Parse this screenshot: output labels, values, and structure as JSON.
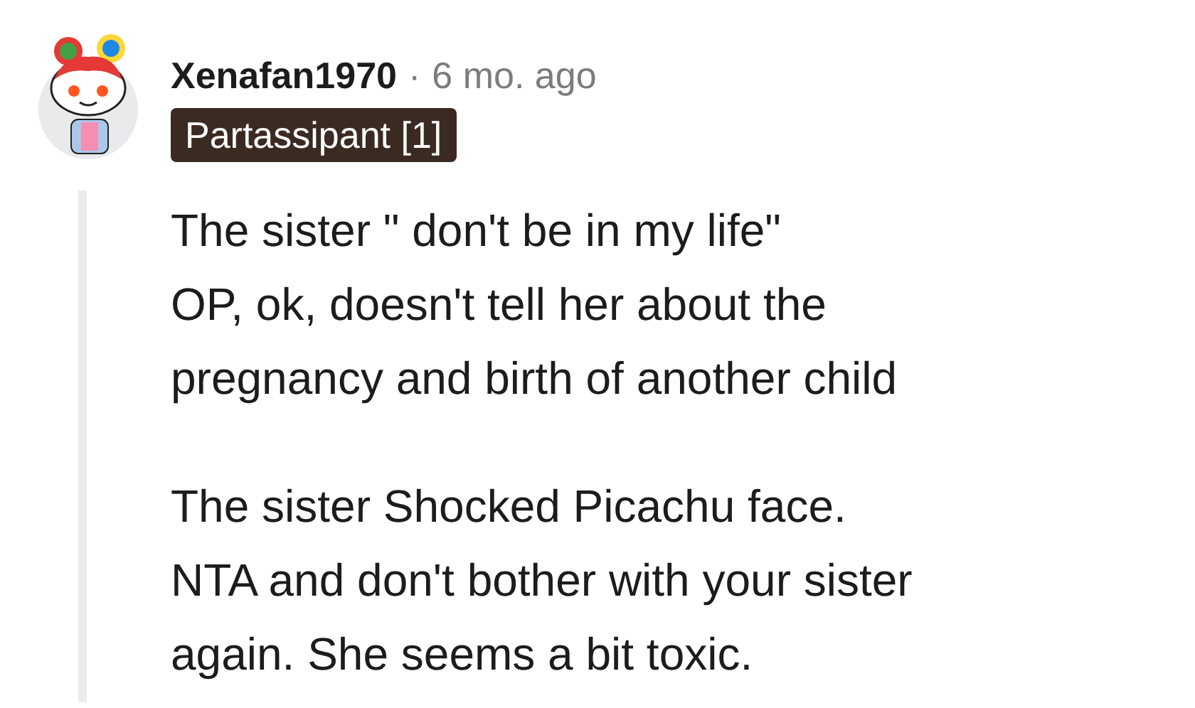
{
  "comment": {
    "author": "Xenafan1970",
    "separator": "·",
    "time": "6 mo. ago",
    "flair": "Partassipant [1]",
    "paragraphs": [
      [
        "The sister \" don't be in my life\"",
        "OP, ok, doesn't tell her about the",
        "pregnancy and birth of another child"
      ],
      [
        "The sister Shocked Picachu face.",
        "NTA and don't bother with your sister",
        "again. She seems a bit toxic."
      ]
    ]
  }
}
